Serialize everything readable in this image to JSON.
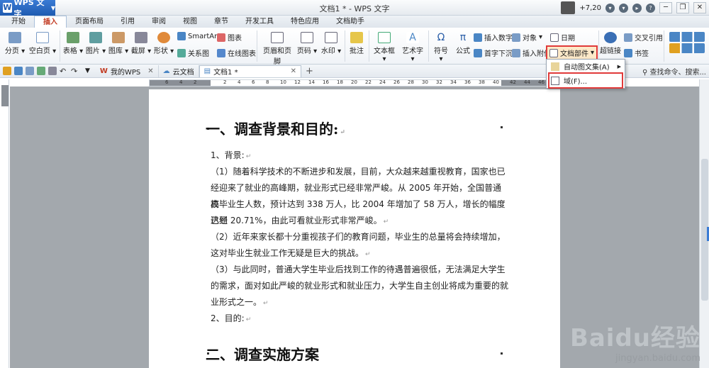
{
  "app": {
    "button": "WPS 文字",
    "window_title": "文档1 * - WPS 文字",
    "score": "+7,20"
  },
  "menu": {
    "tabs": [
      "开始",
      "插入",
      "页面布局",
      "引用",
      "审阅",
      "视图",
      "章节",
      "开发工具",
      "特色应用",
      "文档助手"
    ],
    "active": "插入"
  },
  "ribbon": {
    "fenye": "分页",
    "kongbaiye": "空白页",
    "biaoge": "表格",
    "tupian": "图片",
    "tuku": "图库",
    "jieping": "截屏",
    "xingzhuang": "形状",
    "smartart": "SmartArt",
    "tubiao": "图表",
    "guanxitu": "关系图",
    "zaixiantubiao": "在线图表",
    "yemei": "页眉和页脚",
    "yema": "页码",
    "shuiyin": "水印",
    "pizhu": "批注",
    "wenbenkuang": "文本框",
    "yishuzi": "艺术字",
    "fuhao": "符号",
    "gongshi": "公式",
    "charushuzi": "插入数字",
    "shouzixiachen": "首字下沉",
    "duixiang": "对象",
    "charufujian": "插入附件",
    "riqi": "日期",
    "wendangbujian": "文档部件",
    "chaolianjie": "超链接",
    "jiaochayinyong": "交叉引用",
    "shuqian": "书签"
  },
  "dropdown": {
    "items": [
      "自动图文集(A)",
      "域(F)..."
    ]
  },
  "quickbar": {
    "tabs": [
      "我的WPS",
      "云文档",
      "文档1 *"
    ],
    "search": "查找命令、搜索..."
  },
  "ruler": {
    "labels": [
      "6",
      "4",
      "2",
      "",
      "2",
      "4",
      "6",
      "8",
      "10",
      "12",
      "14",
      "16",
      "18",
      "20",
      "22",
      "24",
      "26",
      "28",
      "30",
      "32",
      "34",
      "36",
      "38",
      "40",
      "42",
      "44",
      "46",
      "48"
    ]
  },
  "doc": {
    "h1": "一、调查背景和目的:",
    "bg": "1、背景:",
    "p1a": "（1）随着科学技术的不断进步和发展，目前，大众越来越重视教育，国家也已",
    "p1b": "经迎来了就业的高峰期，就业形式已经非常严峻。从 2005 年开始，全国普通高",
    "p1c": "校毕业生人数，预计达到 338 万人，比 2004 年增加了 58 万人，增长的幅度已经",
    "p1d": "达到 20.71%，由此可看就业形式非常严峻。",
    "p2a": "（2）近年来家长都十分重视孩子们的教育问题，毕业生的总量将会持续增加，",
    "p2b": "这对毕业生就业工作无疑是巨大的挑战。",
    "p3a": "（3）与此同时，普通大学生毕业后找到工作的待遇普遍很低，无法满足大学生",
    "p3b": "的需求，面对如此严峻的就业形式和就业压力，大学生自主创业将成为重要的就",
    "p3c": "业形式之一。",
    "mudi": "2、目的:",
    "h2": "二、调查实施方案"
  },
  "watermark": {
    "line1": "Baidu经验",
    "line2": "jingyan.baidu.com"
  }
}
